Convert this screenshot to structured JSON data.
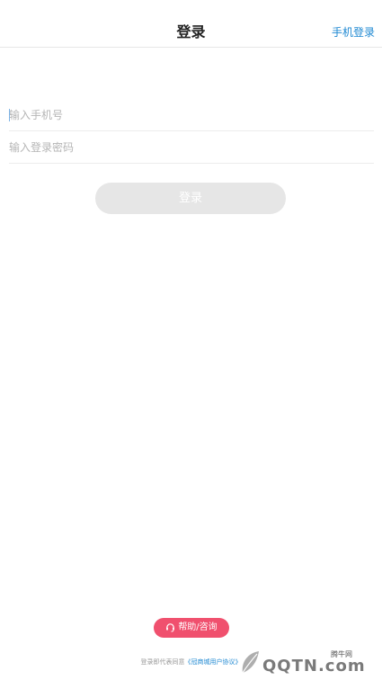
{
  "header": {
    "title": "登录",
    "phone_login": "手机登录"
  },
  "form": {
    "phone_placeholder": "输入手机号",
    "password_placeholder": "输入登录密码",
    "login_button": "登录"
  },
  "help": {
    "label": "帮助/咨询",
    "icon": "headset-icon"
  },
  "agreement": {
    "prefix": "登录即代表同意",
    "link": "《冠商城用户协议》"
  },
  "watermark": {
    "top_text": "腾牛网",
    "brand": "QQTN.com"
  },
  "colors": {
    "accent": "#1e88d2",
    "help_button": "#f0506e",
    "login_button_disabled": "#e6e6e6"
  }
}
